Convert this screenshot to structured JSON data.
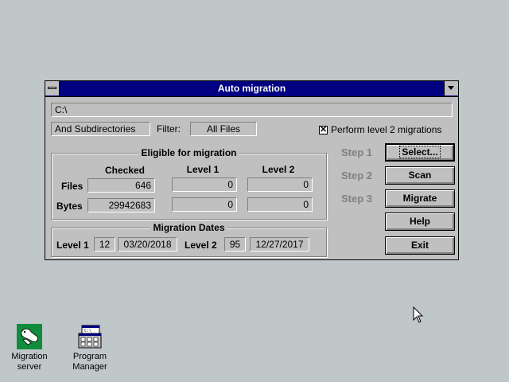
{
  "window": {
    "title": "Auto migration",
    "path": "C:\\",
    "subdirs": "And Subdirectories",
    "filter_label": "Filter:",
    "filter_value": "All Files",
    "perform_level2_label": "Perform level 2 migrations",
    "perform_level2_checked": true
  },
  "eligible": {
    "title": "Eligible for migration",
    "col_checked": "Checked",
    "col_level1": "Level 1",
    "col_level2": "Level 2",
    "row_files": "Files",
    "row_bytes": "Bytes",
    "files": {
      "checked": "646",
      "level1": "0",
      "level2": "0"
    },
    "bytes": {
      "checked": "29942683",
      "level1": "0",
      "level2": "0"
    }
  },
  "dates": {
    "title": "Migration Dates",
    "level1_label": "Level 1",
    "level1_days": "12",
    "level1_date": "03/20/2018",
    "level2_label": "Level 2",
    "level2_days": "95",
    "level2_date": "12/27/2017"
  },
  "steps": {
    "step1": "Step 1",
    "step2": "Step 2",
    "step3": "Step 3"
  },
  "buttons": {
    "select": "Select...",
    "scan": "Scan",
    "migrate": "Migrate",
    "help": "Help",
    "exit": "Exit"
  },
  "desktop": {
    "icon1_line1": "Migration",
    "icon1_line2": "server",
    "icon2_line1": "Program",
    "icon2_line2": "Manager"
  },
  "colors": {
    "desktop": "#c0c7c8",
    "titlebar": "#000080",
    "face": "#c0c0c0"
  }
}
